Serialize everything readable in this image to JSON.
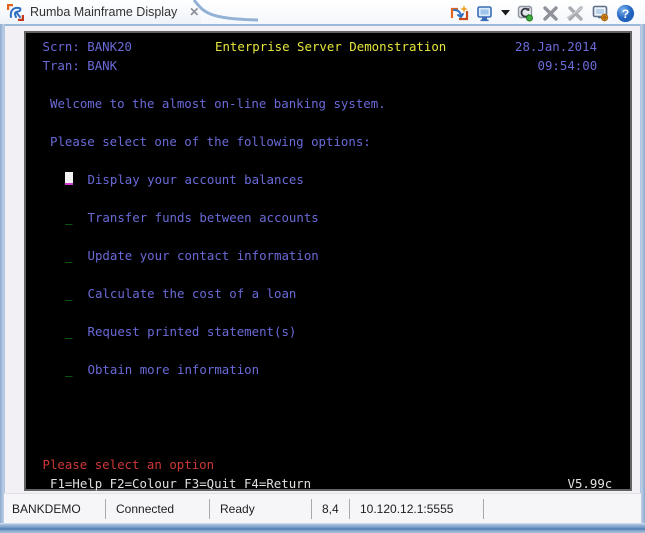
{
  "window": {
    "tab_title": "Rumba Mainframe Display",
    "close_glyph": "✕"
  },
  "toolbar": {
    "icons": [
      {
        "name": "session-wizard-icon"
      },
      {
        "name": "display-icon"
      },
      {
        "name": "dropdown-arrow-icon"
      },
      {
        "name": "reconnect-icon"
      },
      {
        "name": "disconnect-icon"
      },
      {
        "name": "disconnect-all-icon"
      },
      {
        "name": "display-settings-icon"
      },
      {
        "name": "help-icon"
      }
    ]
  },
  "terminal": {
    "colors": {
      "background": "#000000",
      "blue": "#6a6ad8",
      "yellow": "#e6e63c",
      "green": "#1db21d",
      "red": "#cc3838",
      "white": "#e0e0e0",
      "cursor": "#f2f2f2",
      "cursor_underline": "#d633d6"
    },
    "grid": {
      "columns": 80,
      "rows": 24
    },
    "rows": [
      {
        "row": 1,
        "segments": [
          {
            "col": 1,
            "text": "Scrn: BANK20",
            "color": "blue"
          },
          {
            "col": 24,
            "text": "Enterprise Server Demonstration",
            "color": "yellow"
          },
          {
            "col": 64,
            "text": "28.Jan.2014",
            "color": "blue"
          }
        ]
      },
      {
        "row": 2,
        "segments": [
          {
            "col": 1,
            "text": "Tran: BANK",
            "color": "blue"
          },
          {
            "col": 67,
            "text": "09:54:00",
            "color": "blue"
          }
        ]
      },
      {
        "row": 4,
        "segments": [
          {
            "col": 2,
            "text": "Welcome to the almost on-line banking system.",
            "color": "blue"
          }
        ]
      },
      {
        "row": 6,
        "segments": [
          {
            "col": 2,
            "text": "Please select one of the following options:",
            "color": "blue"
          }
        ]
      },
      {
        "row": 8,
        "cursor": {
          "col": 4
        },
        "segments": [
          {
            "col": 7,
            "text": "Display your account balances",
            "color": "blue"
          }
        ]
      },
      {
        "row": 10,
        "segments": [
          {
            "col": 4,
            "text": "_",
            "color": "green",
            "field": true
          },
          {
            "col": 7,
            "text": "Transfer funds between accounts",
            "color": "blue"
          }
        ]
      },
      {
        "row": 12,
        "segments": [
          {
            "col": 4,
            "text": "_",
            "color": "green",
            "field": true
          },
          {
            "col": 7,
            "text": "Update your contact information",
            "color": "blue"
          }
        ]
      },
      {
        "row": 14,
        "segments": [
          {
            "col": 4,
            "text": "_",
            "color": "green",
            "field": true
          },
          {
            "col": 7,
            "text": "Calculate the cost of a loan",
            "color": "blue"
          }
        ]
      },
      {
        "row": 16,
        "segments": [
          {
            "col": 4,
            "text": "_",
            "color": "green",
            "field": true
          },
          {
            "col": 7,
            "text": "Request printed statement(s)",
            "color": "blue"
          }
        ]
      },
      {
        "row": 18,
        "segments": [
          {
            "col": 4,
            "text": "_",
            "color": "green",
            "field": true
          },
          {
            "col": 7,
            "text": "Obtain more information",
            "color": "blue"
          }
        ]
      },
      {
        "row": 23,
        "segments": [
          {
            "col": 1,
            "text": "Please select an option",
            "color": "red"
          }
        ]
      },
      {
        "row": 24,
        "segments": [
          {
            "col": 2,
            "text": "F1=Help F2=Colour F3=Quit F4=Return",
            "color": "white"
          },
          {
            "col": 71,
            "text": "V5.99c",
            "color": "white"
          }
        ]
      }
    ]
  },
  "statusbar": {
    "items": [
      {
        "label": "BANKDEMO"
      },
      {
        "label": "Connected"
      },
      {
        "label": "Ready"
      },
      {
        "label": "8,4"
      },
      {
        "label": "10.120.12.1:5555"
      }
    ]
  }
}
